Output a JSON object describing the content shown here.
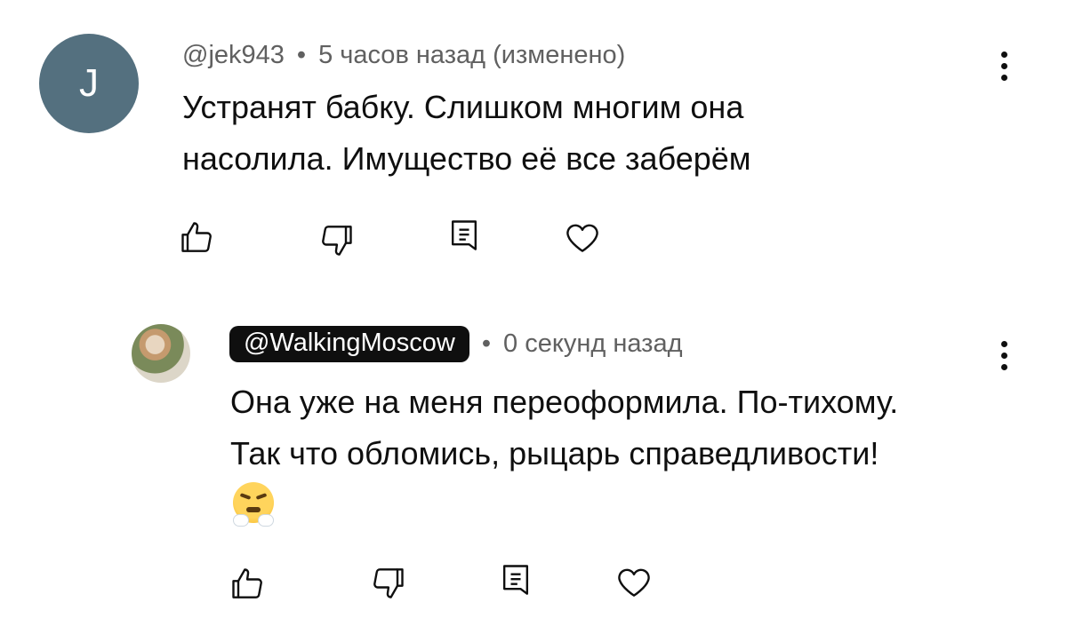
{
  "comments": [
    {
      "avatar_letter": "J",
      "handle": "@jek943",
      "separator": "•",
      "timestamp": "5 часов назад (изменено)",
      "text_line1": "Устранят бабку. Слишком многим она",
      "text_line2": "насолила. Имущество её все заберём",
      "icons": [
        "like-icon",
        "dislike-icon",
        "reply-icon",
        "heart-icon",
        "kebab-menu-icon"
      ]
    },
    {
      "avatar": "user-photo",
      "handle": "@WalkingMoscow",
      "separator": "•",
      "timestamp": "0 секунд назад",
      "text_line1": "Она уже на меня переоформила. По-тихому.",
      "text_line2": "Так что обломись, рыцарь справедливости!",
      "emoji": "face-with-steam-from-nose",
      "icons": [
        "like-icon",
        "dislike-icon",
        "reply-icon",
        "heart-icon",
        "kebab-menu-icon"
      ]
    }
  ],
  "colors": {
    "avatar_bg": "#54707f",
    "meta_text": "#606060",
    "body_text": "#0f0f0f",
    "badge_bg": "#0f0f0f"
  }
}
